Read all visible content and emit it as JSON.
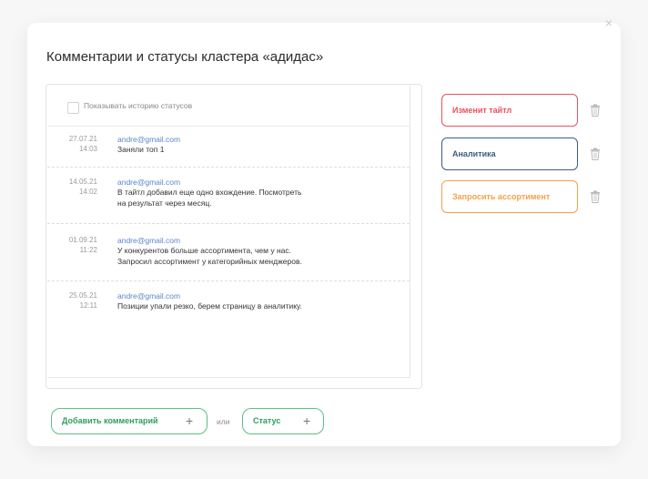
{
  "modal": {
    "title": "Комментарии и статусы кластера «адидас»",
    "close_glyph": "×"
  },
  "history": {
    "toggle_label": "Показывать историю статусов",
    "checked": false,
    "entries": [
      {
        "date": "27.07.21",
        "time": "14:03",
        "email": "andre@gmail.com",
        "lines": [
          "Заняли топ 1"
        ]
      },
      {
        "date": "14.05.21",
        "time": "14:02",
        "email": "andre@gmail.com",
        "lines": [
          "В тайтл добавил еще одно вхождение. Посмотреть",
          "на результат через месяц."
        ]
      },
      {
        "date": "01.09.21",
        "time": "11:22",
        "email": "andre@gmail.com",
        "lines": [
          "У конкурентов больше ассортимента, чем у нас.",
          "Запросил ассортимент у категорийных менджеров."
        ]
      },
      {
        "date": "25.05.21",
        "time": "12:11",
        "email": "andre@gmail.com",
        "lines": [
          "Позиции упали резко, берем страницу в аналитику."
        ]
      }
    ]
  },
  "statuses": [
    {
      "label": "Изменит тайтл",
      "color": "#e8525e"
    },
    {
      "label": "Аналитика",
      "color": "#3d5d7d"
    },
    {
      "label": "Запросить ассортимент",
      "color": "#f5a14a"
    }
  ],
  "actions": {
    "add_comment_label": "Добавить комментарий",
    "or_label": "или",
    "status_label": "Статус",
    "plus_glyph": "+"
  },
  "colors": {
    "accent_green": "#2f9e5f",
    "email_blue": "#5b86c6"
  }
}
